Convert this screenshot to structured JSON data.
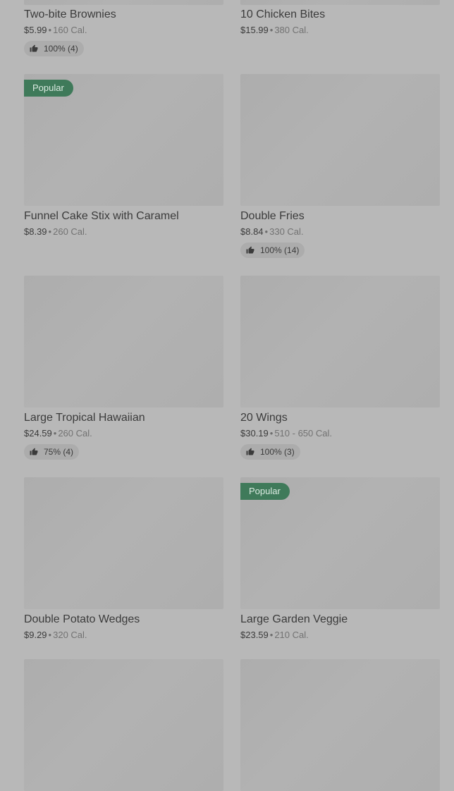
{
  "items": [
    {
      "name": "Two-bite Brownies",
      "price": "$5.99",
      "calories": "160 Cal.",
      "rating": "100% (4)",
      "badge": null
    },
    {
      "name": "10 Chicken Bites",
      "price": "$15.99",
      "calories": "380 Cal.",
      "rating": null,
      "badge": null
    },
    {
      "name": "Funnel Cake Stix with Caramel",
      "price": "$8.39",
      "calories": "260 Cal.",
      "rating": null,
      "badge": "Popular"
    },
    {
      "name": "Double Fries",
      "price": "$8.84",
      "calories": "330 Cal.",
      "rating": "100% (14)",
      "badge": null
    },
    {
      "name": "Large Tropical Hawaiian",
      "price": "$24.59",
      "calories": "260 Cal.",
      "rating": "75% (4)",
      "badge": null
    },
    {
      "name": "20 Wings",
      "price": "$30.19",
      "calories": "510 - 650 Cal.",
      "rating": "100% (3)",
      "badge": null
    },
    {
      "name": "Double Potato Wedges",
      "price": "$9.29",
      "calories": "320 Cal.",
      "rating": null,
      "badge": null
    },
    {
      "name": "Large Garden Veggie",
      "price": "$23.59",
      "calories": "210 Cal.",
      "rating": null,
      "badge": "Popular"
    }
  ],
  "separator": "•",
  "icons": {
    "rating": "thumbs-up-icon"
  },
  "colors": {
    "badge": "#3f7a5a",
    "background": "#b8b8b8"
  }
}
